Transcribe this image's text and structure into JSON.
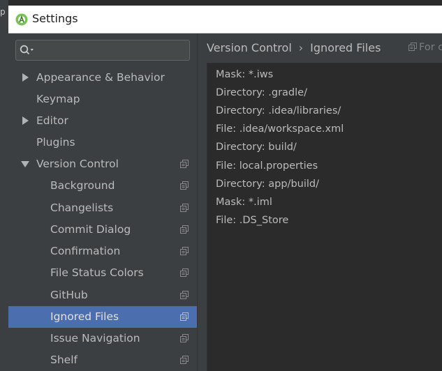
{
  "background": {
    "edge_fragment": "p"
  },
  "window": {
    "title": "Settings"
  },
  "sidebar": {
    "search_placeholder": "",
    "items": [
      {
        "label": "Appearance & Behavior",
        "arrow": "right",
        "level": 0,
        "copy_icon": false,
        "selected": false
      },
      {
        "label": "Keymap",
        "arrow": "none",
        "level": 0,
        "copy_icon": false,
        "selected": false
      },
      {
        "label": "Editor",
        "arrow": "right",
        "level": 0,
        "copy_icon": false,
        "selected": false
      },
      {
        "label": "Plugins",
        "arrow": "none",
        "level": 0,
        "copy_icon": false,
        "selected": false
      },
      {
        "label": "Version Control",
        "arrow": "down",
        "level": 0,
        "copy_icon": true,
        "selected": false
      },
      {
        "label": "Background",
        "arrow": "none",
        "level": 1,
        "copy_icon": true,
        "selected": false
      },
      {
        "label": "Changelists",
        "arrow": "none",
        "level": 1,
        "copy_icon": true,
        "selected": false
      },
      {
        "label": "Commit Dialog",
        "arrow": "none",
        "level": 1,
        "copy_icon": true,
        "selected": false
      },
      {
        "label": "Confirmation",
        "arrow": "none",
        "level": 1,
        "copy_icon": true,
        "selected": false
      },
      {
        "label": "File Status Colors",
        "arrow": "none",
        "level": 1,
        "copy_icon": true,
        "selected": false
      },
      {
        "label": "GitHub",
        "arrow": "none",
        "level": 1,
        "copy_icon": true,
        "selected": false
      },
      {
        "label": "Ignored Files",
        "arrow": "none",
        "level": 1,
        "copy_icon": true,
        "selected": true
      },
      {
        "label": "Issue Navigation",
        "arrow": "none",
        "level": 1,
        "copy_icon": true,
        "selected": false
      },
      {
        "label": "Shelf",
        "arrow": "none",
        "level": 1,
        "copy_icon": true,
        "selected": false
      }
    ]
  },
  "content": {
    "breadcrumb": {
      "parent": "Version Control",
      "separator": "›",
      "current": "Ignored Files"
    },
    "scope_label": "For c",
    "ignored_files": [
      "Mask: *.iws",
      "Directory: .gradle/",
      "Directory: .idea/libraries/",
      "File: .idea/workspace.xml",
      "Directory: build/",
      "File: local.properties",
      "Directory: app/build/",
      "Mask: *.iml",
      "File: .DS_Store"
    ]
  },
  "colors": {
    "panel": "#3c3f41",
    "list_background": "#2b2b2b",
    "selection": "#4b6eaf",
    "text": "#bbbbbb",
    "title_bar": "#ffffff",
    "app_icon": "#78c257"
  }
}
